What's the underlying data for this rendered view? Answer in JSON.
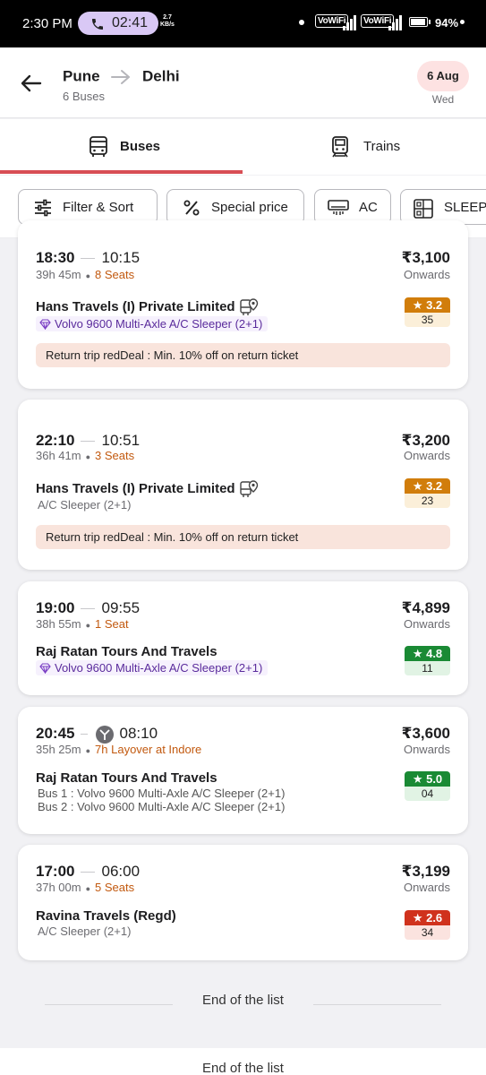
{
  "status_bar": {
    "time": "2:30 PM",
    "call_time": "02:41",
    "net_speed_value": "2.7",
    "net_speed_unit": "KB/s",
    "network1": "VoWiFi",
    "network2": "VoWiFi",
    "battery": "94%"
  },
  "header": {
    "from": "Pune",
    "to": "Delhi",
    "count": "6 Buses",
    "date": "6 Aug",
    "day": "Wed"
  },
  "tabs": [
    {
      "label": "Buses",
      "icon": "bus-icon",
      "active": true
    },
    {
      "label": "Trains",
      "icon": "train-icon",
      "active": false
    }
  ],
  "filters": [
    {
      "label": "Filter & Sort",
      "icon": "sliders-icon"
    },
    {
      "label": "Special price",
      "icon": "percent-icon"
    },
    {
      "label": "AC",
      "icon": "ac-icon"
    },
    {
      "label": "SLEEPER",
      "icon": "sleeper-icon"
    }
  ],
  "colors": {
    "accent": "#d84e55",
    "rating_orange": "#d17d0b",
    "rating_green": "#1a8a34",
    "rating_red": "#d0321d",
    "seats_text": "#c2590f",
    "premium_purple": "#5a2b9c"
  },
  "buses": [
    {
      "dep": "18:30",
      "arr": "10:15",
      "duration": "39h 45m",
      "seats": "8 Seats",
      "price": "₹3,100",
      "onwards": "Onwards",
      "operator": "Hans Travels (I) Private Limited",
      "live_tracking": true,
      "bus_type": "Volvo 9600 Multi-Axle A/C Sleeper (2+1)",
      "premium": true,
      "rating": "3.2",
      "reviews": "35",
      "rating_color": "orange",
      "deal": "Return trip redDeal : Min. 10% off on return ticket"
    },
    {
      "dep": "22:10",
      "arr": "10:51",
      "duration": "36h 41m",
      "seats": "3 Seats",
      "price": "₹3,200",
      "onwards": "Onwards",
      "operator": "Hans Travels (I) Private Limited",
      "live_tracking": true,
      "bus_type": "A/C Sleeper (2+1)",
      "premium": false,
      "rating": "3.2",
      "reviews": "23",
      "rating_color": "orange",
      "deal": "Return trip redDeal : Min. 10% off on return ticket"
    },
    {
      "dep": "19:00",
      "arr": "09:55",
      "duration": "38h 55m",
      "seats": "1 Seat",
      "price": "₹4,899",
      "onwards": "Onwards",
      "operator": "Raj Ratan Tours And Travels",
      "live_tracking": false,
      "bus_type": "Volvo 9600 Multi-Axle A/C Sleeper (2+1)",
      "premium": true,
      "rating": "4.8",
      "reviews": "11",
      "rating_color": "green"
    },
    {
      "dep": "20:45",
      "arr": "08:10",
      "duration": "35h 25m",
      "layover": "7h Layover at Indore",
      "price": "₹3,600",
      "onwards": "Onwards",
      "operator": "Raj Ratan Tours And Travels",
      "live_tracking": false,
      "legs": [
        "Bus 1 : Volvo 9600 Multi-Axle A/C Sleeper (2+1)",
        "Bus 2 : Volvo 9600 Multi-Axle A/C Sleeper (2+1)"
      ],
      "rating": "5.0",
      "reviews": "04",
      "rating_color": "green"
    },
    {
      "dep": "17:00",
      "arr": "06:00",
      "duration": "37h 00m",
      "seats": "5 Seats",
      "price": "₹3,199",
      "onwards": "Onwards",
      "operator": "Ravina Travels (Regd)",
      "live_tracking": false,
      "bus_type": "A/C Sleeper (2+1)",
      "premium": false,
      "rating": "2.6",
      "reviews": "34",
      "rating_color": "red"
    }
  ],
  "end_of_list": "End of the list"
}
